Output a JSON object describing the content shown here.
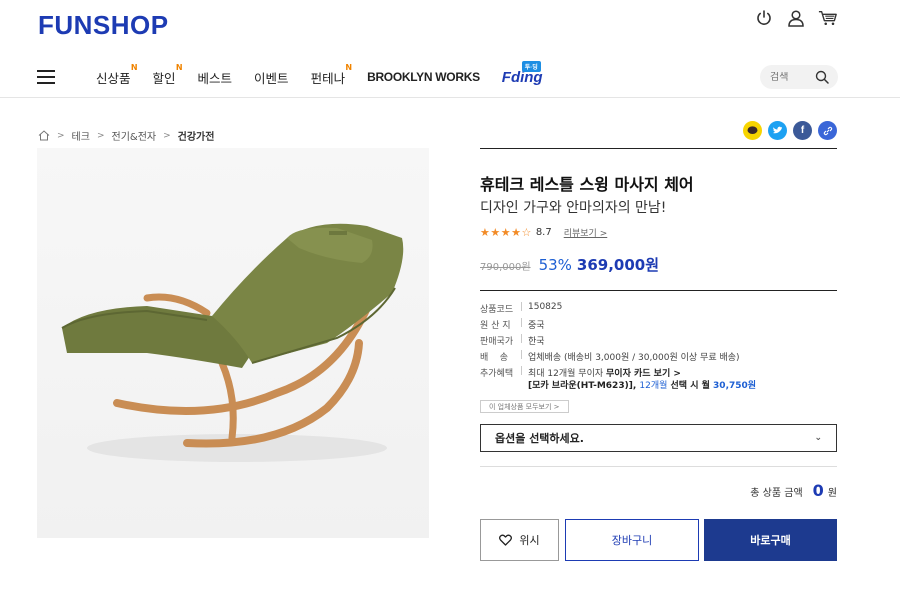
{
  "header": {
    "logo": "FUNSHOP",
    "icons": [
      "power-icon",
      "user-icon",
      "cart-icon"
    ]
  },
  "nav": {
    "items": [
      {
        "label": "신상품",
        "badge": "N"
      },
      {
        "label": "할인",
        "badge": "N"
      },
      {
        "label": "베스트",
        "badge": ""
      },
      {
        "label": "이벤트",
        "badge": ""
      },
      {
        "label": "펀테나",
        "badge": "N"
      }
    ],
    "brand_link": "BROOKLYN WORKS",
    "fding": {
      "label": "Fding",
      "tag": "투·딩"
    },
    "search_placeholder": "검색"
  },
  "breadcrumb": {
    "items": [
      "테크",
      "전기&전자",
      "건강가전"
    ]
  },
  "share": {
    "icons": [
      "kakao-icon",
      "twitter-icon",
      "facebook-icon",
      "link-icon"
    ],
    "facebook_glyph": "f"
  },
  "product": {
    "title": "휴테크 레스틀 스윙 마사지 체어",
    "subtitle": "디자인 가구와 안마의자의 만남!",
    "stars": "★★★★☆",
    "rating": "8.7",
    "review_link": "리뷰보기 >",
    "original_price": "790,000원",
    "discount": "53%",
    "price": "369,000원",
    "info": [
      {
        "key": "상품코드",
        "value": "150825"
      },
      {
        "key": "원 산 지",
        "value": "중국"
      },
      {
        "key": "판매국가",
        "value": "한국"
      },
      {
        "key": "배    송",
        "value": "업체배송 (배송비 3,000원 / 30,000원 이상 무료 배송)"
      },
      {
        "key": "추가혜택",
        "value": "최대 12개월 무이자",
        "value_bold": "무이자 카드 보기 >"
      }
    ],
    "info_extra": {
      "prefix": "[모카 브라운(HT-M623)], ",
      "months": "12개월",
      "mid": " 선택 시 월 ",
      "amount": "30,750원"
    },
    "related_button": "이 업체상품 모두보기 >",
    "option_placeholder": "옵션을 선택하세요.",
    "total_label": "총 상품 금액",
    "total_amount": "0",
    "total_unit": "원",
    "wish_label": "위시",
    "cart_label": "장바구니",
    "buy_label": "바로구매"
  },
  "colors": {
    "brand": "#1d3bb3",
    "buy_button": "#1d3a8f",
    "stars": "#f28b27",
    "chair_upholstery": "#6f7a3e",
    "chair_wood": "#c98d54"
  }
}
